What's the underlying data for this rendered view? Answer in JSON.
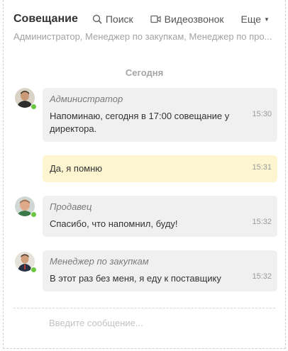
{
  "header": {
    "title": "Совещание",
    "search_label": "Поиск",
    "video_label": "Видеозвонок",
    "more_label": "Еще"
  },
  "members": "Администратор, Менеджер по закупкам, Менеджер по про...",
  "date_separator": "Сегодня",
  "messages": [
    {
      "author": "Администратор",
      "text": "Напоминаю, сегодня в 17:00 совещание у директора.",
      "time": "15:30"
    },
    {
      "author": "",
      "text": "Да, я помню",
      "time": "15:31"
    },
    {
      "author": "Продавец",
      "text": "Спасибо, что напомнил, буду!",
      "time": "15:32"
    },
    {
      "author": "Менеджер по закупкам",
      "text": "В этот раз без меня, я еду к поставщику",
      "time": "15:32"
    }
  ],
  "composer": {
    "placeholder": "Введите сообщение..."
  },
  "colors": {
    "own_message_bg": "#fdf5d0",
    "message_bg": "#f0f0f0",
    "online": "#6bc641"
  }
}
